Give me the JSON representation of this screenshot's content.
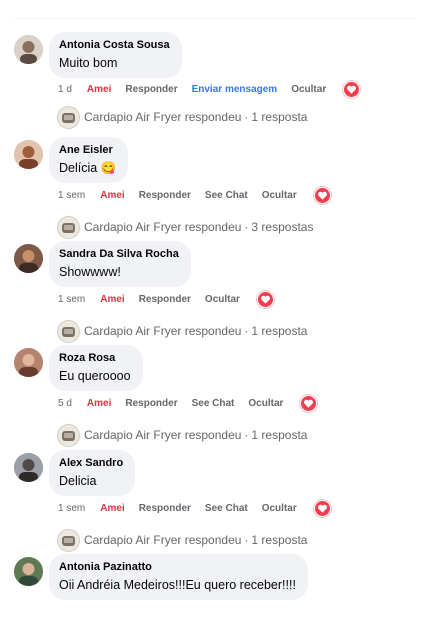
{
  "comments": [
    {
      "author": "Antonia Costa Sousa",
      "text": "Muito bom",
      "time": "1 d",
      "actions": [
        "Amei",
        "Responder",
        "Enviar mensagem",
        "Ocultar"
      ],
      "reply_author": "Cardapio Air Fryer respondeu",
      "reply_count": "1 resposta"
    },
    {
      "author": "Ane Eisler",
      "text": "Delícia 😋",
      "time": "1 sem",
      "actions": [
        "Amei",
        "Responder",
        "See Chat",
        "Ocultar"
      ],
      "reply_author": "Cardapio Air Fryer respondeu",
      "reply_count": "3 respostas"
    },
    {
      "author": "Sandra Da Silva Rocha",
      "text": "Showwww!",
      "time": "1 sem",
      "actions": [
        "Amei",
        "Responder",
        "Ocultar"
      ],
      "reply_author": "Cardapio Air Fryer respondeu",
      "reply_count": "1 resposta"
    },
    {
      "author": "Roza Rosa",
      "text": "Eu queroooo",
      "time": "5 d",
      "actions": [
        "Amei",
        "Responder",
        "See Chat",
        "Ocultar"
      ],
      "reply_author": "Cardapio Air Fryer respondeu",
      "reply_count": "1 resposta"
    },
    {
      "author": "Alex Sandro",
      "text": "Delicia",
      "time": "1 sem",
      "actions": [
        "Amei",
        "Responder",
        "See Chat",
        "Ocultar"
      ],
      "reply_author": "Cardapio Air Fryer respondeu",
      "reply_count": "1 resposta"
    }
  ],
  "last_comment": {
    "author": "Antonia Pazinatto",
    "text": "Oii Andréia Medeiros!!!Eu quero receber!!!!"
  },
  "colors": {
    "amei": "#e0323f",
    "link": "#3578e5",
    "heart": "#f03e4f",
    "bubble": "#f0f2f5",
    "meta": "#65676b"
  },
  "icons": {
    "reaction": "heart-icon",
    "avatar": "avatar"
  }
}
